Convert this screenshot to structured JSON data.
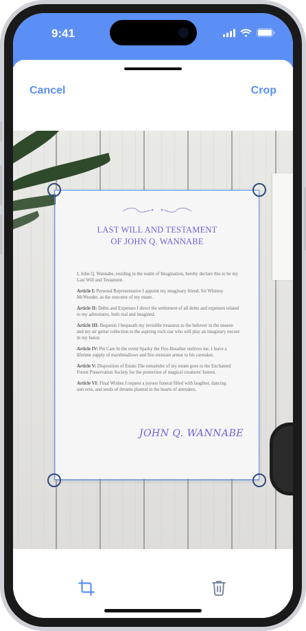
{
  "status_bar": {
    "time": "9:41"
  },
  "sheet": {
    "cancel_label": "Cancel",
    "crop_label": "Crop"
  },
  "document": {
    "title_line1": "LAST WILL AND TESTAMENT",
    "title_line2": "OF JOHN Q. WANNABE",
    "intro": "I, John Q. Wannabe, residing in the realm of Imagination, hereby declare this to be my Last Will and Testament.",
    "articles": [
      {
        "heading": "Article I:",
        "text": "Personal Representative I appoint my imaginary friend, Sir Whimsy McWonder, as the executor of my estate."
      },
      {
        "heading": "Article II:",
        "text": "Debts and Expenses I direct the settlement of all debts and expenses related to my adventures, both real and imagined."
      },
      {
        "heading": "Article III:",
        "text": "Bequests I bequeath my invisible treasures to the believer in the unseen and my air guitar collection to the aspiring rock star who will play an imaginary encore in my honor."
      },
      {
        "heading": "Article IV:",
        "text": "Pet Care In the event Sparky the Fire-Breather outlives me, I leave a lifetime supply of marshmallows and fire-resistant armor to his caretaker."
      },
      {
        "heading": "Article V:",
        "text": "Disposition of Estate The remainder of my estate goes to the Enchanted Forest Preservation Society for the protection of magical creatures' homes."
      },
      {
        "heading": "Article VI:",
        "text": "Final Wishes I request a joyous funeral filled with laughter, dancing unicorns, and seeds of dreams planted in the hearts of attendees."
      }
    ],
    "signature": "JOHN Q. WANNABE"
  },
  "toolbar": {
    "crop_tool_icon": "crop-icon",
    "delete_icon": "trash-icon"
  },
  "colors": {
    "accent": "#5b8ff5",
    "title": "#6f60d8"
  }
}
